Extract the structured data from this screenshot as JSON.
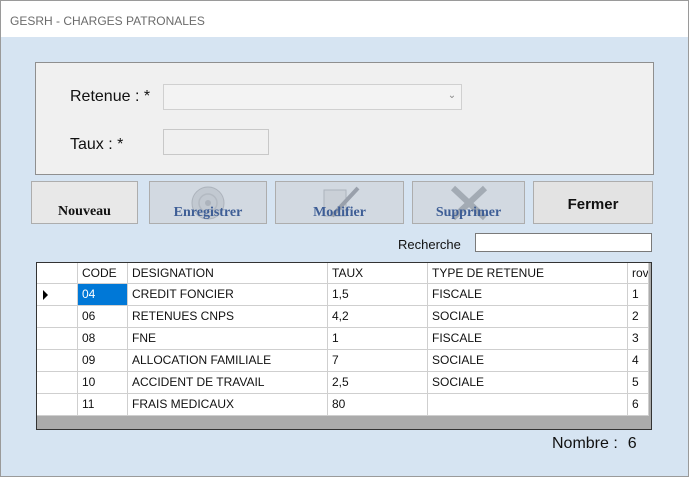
{
  "window": {
    "title": "GESRH - CHARGES PATRONALES"
  },
  "form": {
    "retenue_label": "Retenue : *",
    "retenue_value": "",
    "taux_label": "Taux : *",
    "taux_value": ""
  },
  "toolbar": {
    "nouveau": "Nouveau",
    "enregistrer": "Enregistrer",
    "modifier": "Modifier",
    "supprimer": "Supprimer",
    "fermer": "Fermer"
  },
  "search": {
    "label": "Recherche",
    "value": ""
  },
  "grid": {
    "columns": [
      "CODE",
      "DESIGNATION",
      "TAUX",
      "TYPE DE RETENUE",
      "rov"
    ],
    "rows": [
      [
        "04",
        "CREDIT FONCIER",
        "1,5",
        "FISCALE",
        "1"
      ],
      [
        "06",
        "RETENUES CNPS",
        "4,2",
        "SOCIALE",
        "2"
      ],
      [
        "08",
        "FNE",
        "1",
        "FISCALE",
        "3"
      ],
      [
        "09",
        "ALLOCATION FAMILIALE",
        "7",
        "SOCIALE",
        "4"
      ],
      [
        "10",
        "ACCIDENT DE TRAVAIL",
        "2,5",
        "SOCIALE",
        "5"
      ],
      [
        "11",
        "FRAIS MEDICAUX",
        "80",
        "",
        "6"
      ]
    ],
    "selected_row": 0
  },
  "footer": {
    "nombre_label": "Nombre :",
    "nombre_value": "6"
  },
  "icons": {
    "enregistrer": "save-disk-icon",
    "modifier": "pencil-icon",
    "supprimer": "delete-x-icon"
  }
}
